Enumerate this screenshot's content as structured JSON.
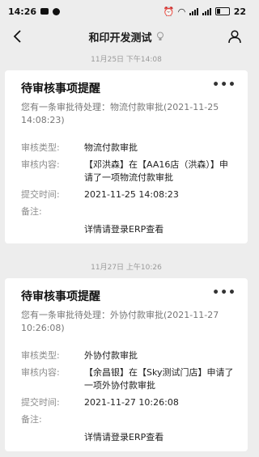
{
  "status_bar": {
    "time": "14:26",
    "battery": "22"
  },
  "nav": {
    "title": "和印开发测试"
  },
  "messages": [
    {
      "timestamp": "11月25日 下午14:08",
      "card": {
        "title": "待审核事项提醒",
        "subtitle": "您有一条审批待处理：物流付款审批(2021-11-25 14:08:23)",
        "fields": [
          {
            "label": "审核类型:",
            "value": "物流付款审批"
          },
          {
            "label": "审核内容:",
            "value": "【邓洪森】在【AA16店（洪森）】申请了一项物流付款审批"
          },
          {
            "label": "提交时间:",
            "value": "2021-11-25 14:08:23"
          },
          {
            "label": "备注:",
            "value": ""
          }
        ],
        "detail": "详情请登录ERP查看"
      }
    },
    {
      "timestamp": "11月27日 上午10:26",
      "card": {
        "title": "待审核事项提醒",
        "subtitle": "您有一条审批待处理：外协付款审批(2021-11-27 10:26:08)",
        "fields": [
          {
            "label": "审核类型:",
            "value": "外协付款审批"
          },
          {
            "label": "审核内容:",
            "value": "【余昌银】在【Sky测试门店】申请了一项外协付款审批"
          },
          {
            "label": "提交时间:",
            "value": "2021-11-27 10:26:08"
          },
          {
            "label": "备注:",
            "value": ""
          }
        ],
        "detail": "详情请登录ERP查看"
      }
    }
  ]
}
